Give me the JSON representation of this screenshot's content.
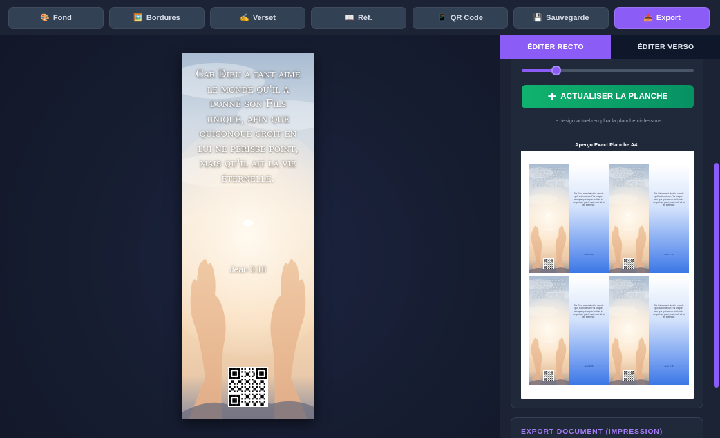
{
  "toolbar": {
    "buttons": [
      {
        "icon": "🎨",
        "label": "Fond"
      },
      {
        "icon": "🖼️",
        "label": "Bordures"
      },
      {
        "icon": "✍️",
        "label": "Verset"
      },
      {
        "icon": "📖",
        "label": "Réf."
      },
      {
        "icon": "📱",
        "label": "QR Code"
      },
      {
        "icon": "💾",
        "label": "Sauvegarde"
      },
      {
        "icon": "📤",
        "label": "Export"
      }
    ],
    "active": "Export",
    "accent_color": "#8b5cf6"
  },
  "bookmark": {
    "verse": "Car Dieu a tant aimé le monde qu'il a donné son Fils unique, afin que quiconque croit en lui ne périsse point, mais qu'il ait la vie éternelle.",
    "reference": "Jean 3:16"
  },
  "panel": {
    "tabs": [
      "ÉDITER RECTO",
      "ÉDITER VERSO"
    ],
    "active_tab": "ÉDITER RECTO",
    "slider_value": 0.2,
    "refresh_button": "ACTUALISER LA PLANCHE",
    "hint": "Le design actuel remplira la planche ci-dessous.",
    "preview_title": "Aperçu Exact Planche A4 :",
    "export_title": "EXPORT DOCUMENT (IMPRESSION)",
    "success_color": "#10b26e"
  }
}
